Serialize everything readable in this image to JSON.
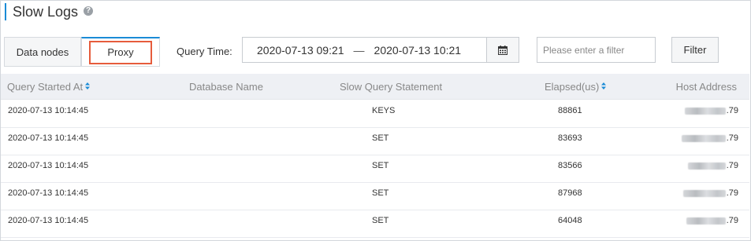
{
  "page": {
    "title": "Slow Logs",
    "help_icon": "question-circle-icon"
  },
  "tabs": [
    {
      "label": "Data nodes",
      "active": false
    },
    {
      "label": "Proxy",
      "active": true,
      "highlighted": true
    }
  ],
  "query": {
    "label": "Query Time:",
    "start": "2020-07-13 09:21",
    "separator": "—",
    "end": "2020-07-13 10:21",
    "calendar_icon": "calendar-icon"
  },
  "filter": {
    "placeholder": "Please enter a filter",
    "value": "",
    "button_label": "Filter"
  },
  "table": {
    "columns": [
      "Query Started At",
      "Database Name",
      "Slow Query Statement",
      "Elapsed(us)",
      "Host Address"
    ],
    "sortable": [
      "Query Started At",
      "Elapsed(us)"
    ],
    "rows": [
      {
        "started": "2020-07-13 10:14:45",
        "database": "",
        "statement": "KEYS",
        "elapsed": "88861",
        "host": ".79"
      },
      {
        "started": "2020-07-13 10:14:45",
        "database": "",
        "statement": "SET",
        "elapsed": "83693",
        "host": ".79"
      },
      {
        "started": "2020-07-13 10:14:45",
        "database": "",
        "statement": "SET",
        "elapsed": "83566",
        "host": ".79"
      },
      {
        "started": "2020-07-13 10:14:45",
        "database": "",
        "statement": "SET",
        "elapsed": "87968",
        "host": ".79"
      },
      {
        "started": "2020-07-13 10:14:45",
        "database": "",
        "statement": "SET",
        "elapsed": "64048",
        "host": ".79"
      }
    ]
  },
  "colors": {
    "accent": "#1a8bd6",
    "highlight_box": "#e65c3c",
    "header_bg": "#eef0f4"
  }
}
